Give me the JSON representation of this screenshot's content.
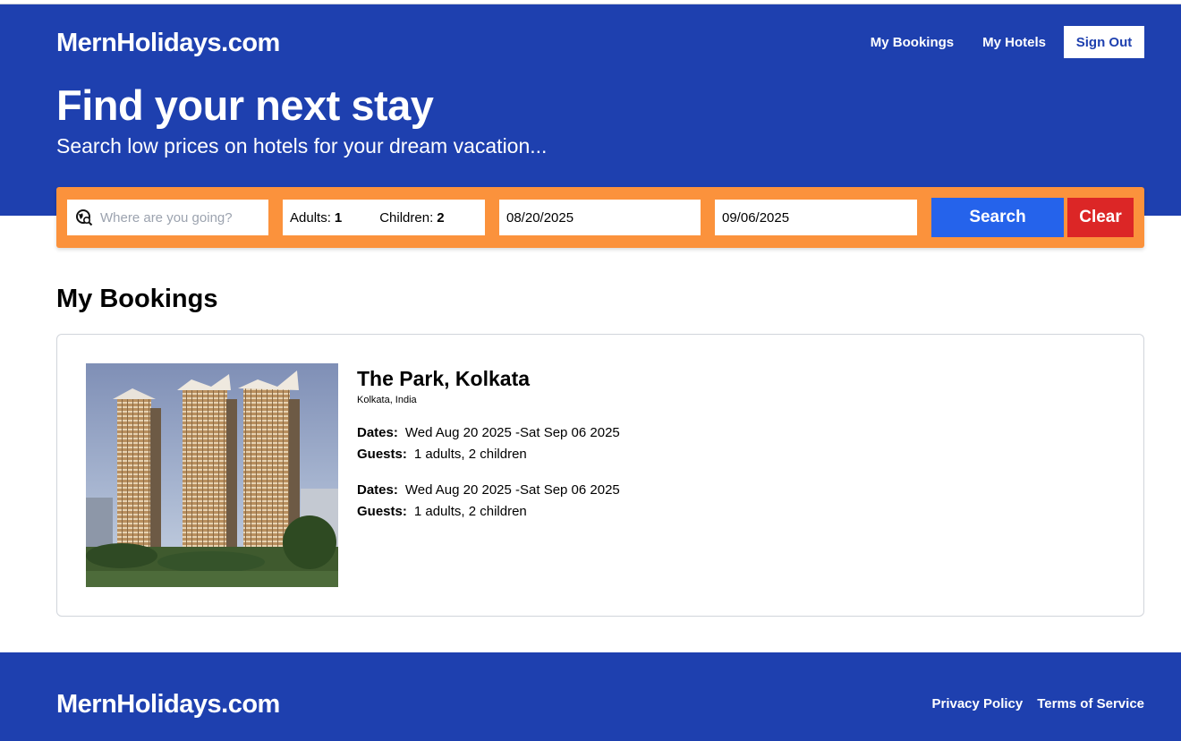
{
  "header": {
    "logo": "MernHolidays.com",
    "nav": {
      "my_bookings": "My Bookings",
      "my_hotels": "My Hotels",
      "sign_out": "Sign Out"
    }
  },
  "hero": {
    "title": "Find your next stay",
    "subtitle": "Search low prices on hotels for your dream vacation..."
  },
  "search": {
    "destination_placeholder": "Where are you going?",
    "destination_icon": "globe-search-icon",
    "adults_label": "Adults:",
    "adults_value": "1",
    "children_label": "Children:",
    "children_value": "2",
    "check_in": "08/20/2025",
    "check_out": "09/06/2025",
    "search_button": "Search",
    "clear_button": "Clear",
    "colors": {
      "bar": "#fb923c",
      "search_button": "#2563eb",
      "clear_button": "#dc2626"
    }
  },
  "main": {
    "section_title": "My Bookings",
    "hotel": {
      "name": "The Park, Kolkata",
      "location": "Kolkata, India",
      "bookings": [
        {
          "dates_label": "Dates:",
          "dates": "Wed Aug 20 2025 -Sat Sep 06 2025",
          "guests_label": "Guests:",
          "guests": "1 adults, 2 children"
        },
        {
          "dates_label": "Dates:",
          "dates": "Wed Aug 20 2025 -Sat Sep 06 2025",
          "guests_label": "Guests:",
          "guests": "1 adults, 2 children"
        }
      ]
    }
  },
  "footer": {
    "logo": "MernHolidays.com",
    "privacy": "Privacy Policy",
    "terms": "Terms of Service"
  },
  "theme": {
    "brand_blue": "#1e40af"
  }
}
